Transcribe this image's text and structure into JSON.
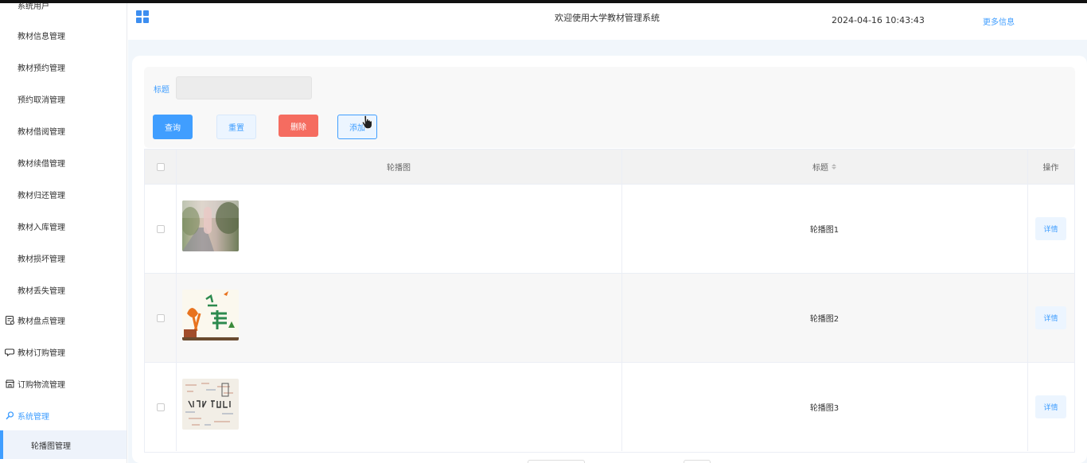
{
  "sidebar": {
    "cut_item": "系统用户",
    "items": [
      {
        "label": "教材信息管理"
      },
      {
        "label": "教材预约管理"
      },
      {
        "label": "预约取消管理"
      },
      {
        "label": "教材借阅管理"
      },
      {
        "label": "教材续借管理"
      },
      {
        "label": "教材归还管理"
      },
      {
        "label": "教材入库管理"
      },
      {
        "label": "教材损坏管理"
      },
      {
        "label": "教材丢失管理"
      }
    ],
    "groups": [
      {
        "label": "教材盘点管理",
        "icon": "clipboard-icon"
      },
      {
        "label": "教材订购管理",
        "icon": "chat-icon"
      },
      {
        "label": "订购物流管理",
        "icon": "store-icon"
      },
      {
        "label": "系统管理",
        "icon": "search-icon"
      }
    ],
    "active_item": "轮播图管理"
  },
  "header": {
    "title": "欢迎使用大学教材管理系统",
    "datetime": "2024-04-16 10:43:43",
    "more": "更多信息",
    "menu_icon": "grid-menu-icon"
  },
  "search": {
    "label": "标题",
    "value": "",
    "placeholder": ""
  },
  "buttons": {
    "query": "查询",
    "reset": "重置",
    "delete": "删除",
    "add": "添加"
  },
  "table": {
    "columns": {
      "image": "轮播图",
      "title": "标题",
      "action": "操作"
    },
    "rows": [
      {
        "title": "轮播图1",
        "action": "详情",
        "image": "campus-road-photo"
      },
      {
        "title": "轮播图2",
        "action": "详情",
        "image": "youth-poster-image"
      },
      {
        "title": "轮播图3",
        "action": "详情",
        "image": "back-to-school-image"
      }
    ]
  },
  "colors": {
    "primary": "#409eff",
    "danger": "#f56c60"
  }
}
